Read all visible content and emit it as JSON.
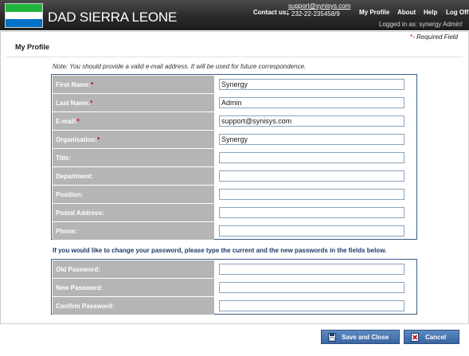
{
  "header": {
    "brand": "DAD SIERRA LEONE",
    "contact_label": "Contact us:",
    "contact_email": "support@synisys.com",
    "contact_phone": "+ 232-22-235458/9",
    "nav": [
      "My Profile",
      "About",
      "Help",
      "Log Off"
    ],
    "logged_in": "Logged in as:  synergy  Admin!"
  },
  "required_note": {
    "mark": "*",
    "text": "- Required Field"
  },
  "page_title": "My Profile",
  "note": "Note: You should provide a valid e-mail address. It will be used for future correspondence.",
  "profile_fields": [
    {
      "label": "First Name:",
      "required": "*",
      "value": "Synergy"
    },
    {
      "label": "Last Name:",
      "required": "*",
      "value": "Admin"
    },
    {
      "label": "E-mail:",
      "required": "*",
      "value": "support@synisys.com"
    },
    {
      "label": "Organisation:",
      "required": "*",
      "value": "Synergy"
    },
    {
      "label": "Title:",
      "required": "",
      "value": ""
    },
    {
      "label": "Department:",
      "required": "",
      "value": ""
    },
    {
      "label": "Position:",
      "required": "",
      "value": ""
    },
    {
      "label": "Postal Address:",
      "required": "",
      "value": ""
    },
    {
      "label": "Phone:",
      "required": "",
      "value": ""
    }
  ],
  "password_info": "If you would like to change your password, please type the current and the new passwords in the fields below.",
  "password_fields": [
    {
      "label": "Old Password:",
      "value": ""
    },
    {
      "label": "New Password:",
      "value": ""
    },
    {
      "label": "Confirm Password:",
      "value": ""
    }
  ],
  "buttons": {
    "save": "Save and Close",
    "cancel": "Cancel"
  },
  "colors": {
    "header": "#2a2a2a",
    "label_bg": "#b5b5b5",
    "required": "#c00000",
    "button": "#3a66a0",
    "box_border": "#3b5b86"
  },
  "icons": [
    "sierra-leone-flag-icon",
    "save-icon",
    "cancel-icon"
  ]
}
